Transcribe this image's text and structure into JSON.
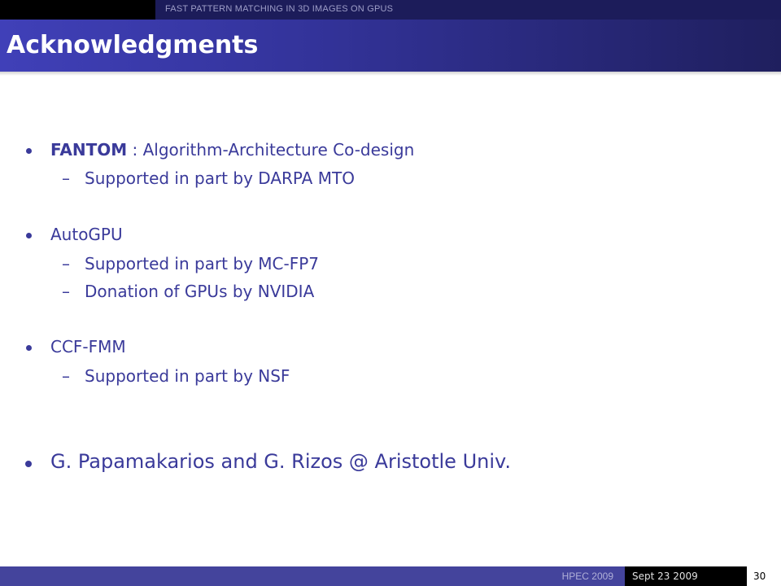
{
  "header": {
    "running_title": "FAST PATTERN MATCHING IN 3D IMAGES ON GPUS",
    "slide_title": "Acknowledgments"
  },
  "body": {
    "fantom": {
      "name": "FANTOM",
      "rest": " : Algorithm-Architecture Co-design"
    },
    "fantom_sub": [
      "Supported in part by DARPA MTO"
    ],
    "autogpu": "AutoGPU",
    "autogpu_sub": [
      "Supported in part by MC-FP7",
      "Donation of GPUs by NVIDIA"
    ],
    "ccf": "CCF-FMM",
    "ccf_sub": [
      "Supported in part by NSF"
    ],
    "thanks": "G. Papamakarios and G. Rizos @ Aristotle Univ."
  },
  "footer": {
    "conference": "HPEC 2009",
    "date": "Sept 23 2009",
    "page_number": "30"
  },
  "colors": {
    "title_bar_start": "#4040b8",
    "title_bar_end": "#1f1f5e",
    "body_text": "#3a3a9a",
    "footer_blue": "#44449c"
  }
}
